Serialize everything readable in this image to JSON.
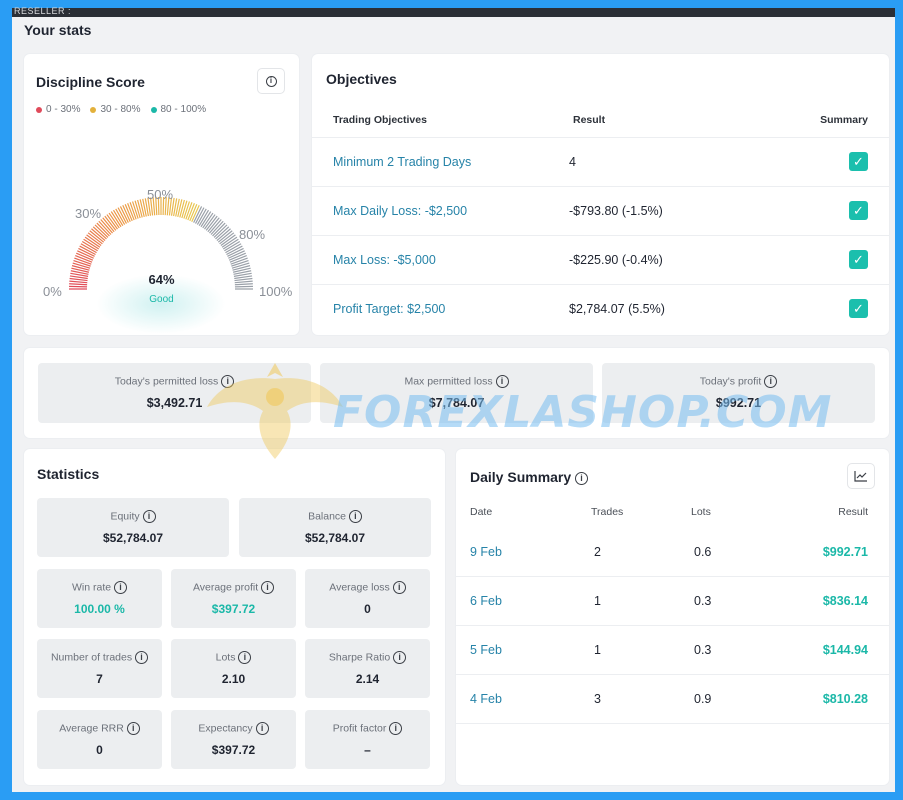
{
  "top_bar": {
    "label": "RESELLER :"
  },
  "page": {
    "title": "Your stats"
  },
  "discipline": {
    "title": "Discipline Score",
    "legend": [
      {
        "label": "0 - 30%",
        "color": "#e04a5a"
      },
      {
        "label": "30 - 80%",
        "color": "#e3b13b"
      },
      {
        "label": "80 - 100%",
        "color": "#1bb8a8"
      }
    ],
    "gauge_labels": {
      "p0": "0%",
      "p30": "30%",
      "p50": "50%",
      "p80": "80%",
      "p100": "100%"
    },
    "value": "64%",
    "value_fraction": 0.64,
    "status": "Good"
  },
  "objectives": {
    "title": "Objectives",
    "headers": {
      "objective": "Trading Objectives",
      "result": "Result",
      "summary": "Summary"
    },
    "rows": [
      {
        "name": "Minimum 2 Trading Days",
        "result": "4",
        "check": "✓"
      },
      {
        "name": "Max Daily Loss: -$2,500",
        "result": "-$793.80 (-1.5%)",
        "check": "✓"
      },
      {
        "name": "Max Loss: -$5,000",
        "result": "-$225.90 (-0.4%)",
        "check": "✓"
      },
      {
        "name": "Profit Target: $2,500",
        "result": "$2,784.07 (5.5%)",
        "check": "✓"
      }
    ]
  },
  "permitted": [
    {
      "label": "Today's permitted loss",
      "value": "$3,492.71"
    },
    {
      "label": "Max permitted loss",
      "value": "$7,784.07"
    },
    {
      "label": "Today's profit",
      "value": "$992.71"
    }
  ],
  "statistics": {
    "title": "Statistics",
    "equity": {
      "label": "Equity",
      "value": "$52,784.07"
    },
    "balance": {
      "label": "Balance",
      "value": "$52,784.07"
    },
    "grid": [
      {
        "label": "Win rate",
        "value": "100.00 %",
        "accent": true
      },
      {
        "label": "Average profit",
        "value": "$397.72",
        "accent": true
      },
      {
        "label": "Average loss",
        "value": "0",
        "accent": false
      },
      {
        "label": "Number of trades",
        "value": "7",
        "accent": false
      },
      {
        "label": "Lots",
        "value": "2.10",
        "accent": false
      },
      {
        "label": "Sharpe Ratio",
        "value": "2.14",
        "accent": false
      },
      {
        "label": "Average RRR",
        "value": "0",
        "accent": false
      },
      {
        "label": "Expectancy",
        "value": "$397.72",
        "accent": false
      },
      {
        "label": "Profit factor",
        "value": "–",
        "accent": false
      }
    ]
  },
  "daily_summary": {
    "title": "Daily Summary",
    "headers": {
      "date": "Date",
      "trades": "Trades",
      "lots": "Lots",
      "result": "Result"
    },
    "rows": [
      {
        "date": "9 Feb",
        "trades": "2",
        "lots": "0.6",
        "result": "$992.71"
      },
      {
        "date": "6 Feb",
        "trades": "1",
        "lots": "0.3",
        "result": "$836.14"
      },
      {
        "date": "5 Feb",
        "trades": "1",
        "lots": "0.3",
        "result": "$144.94"
      },
      {
        "date": "4 Feb",
        "trades": "3",
        "lots": "0.9",
        "result": "$810.28"
      }
    ]
  },
  "watermark": {
    "text": "FOREXLASHOP.COM"
  },
  "colors": {
    "accent": "#1bb8a8",
    "link": "#2683a8",
    "frame": "#2a9df4"
  },
  "icons": {
    "info": "info-icon",
    "chart": "line-chart-icon",
    "check": "check-icon"
  }
}
